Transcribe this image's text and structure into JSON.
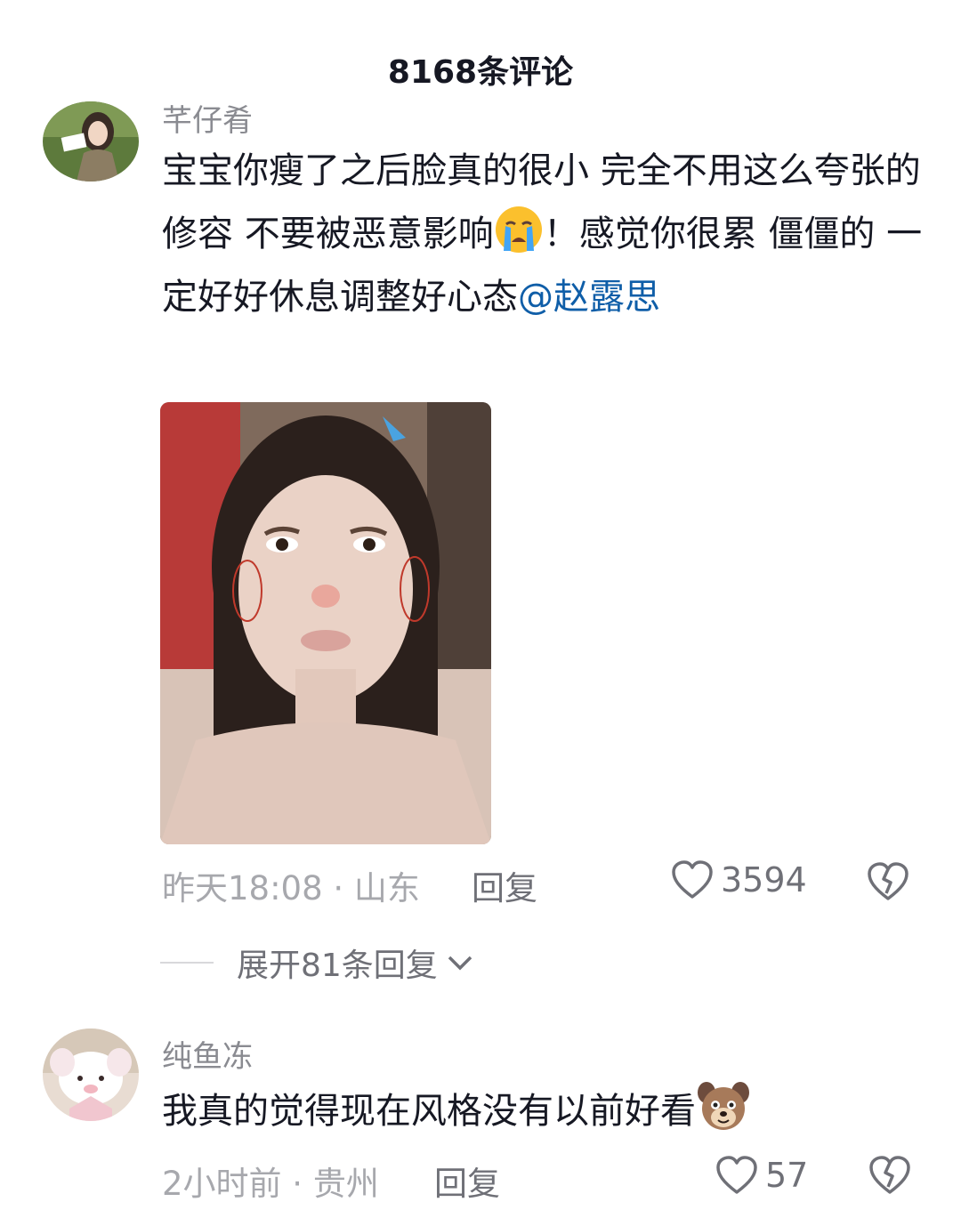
{
  "header": {
    "title": "8168条评论"
  },
  "comments": [
    {
      "username": "芊仔肴",
      "text_parts": [
        "宝宝你瘦了之后脸真的很小 完全不用这么夸张的修容 不要被恶意影响",
        "！感觉你很累 僵僵的 一定好好休息调整好心态"
      ],
      "mention": "@赵露思",
      "emoji": "crying-face-icon",
      "time_location": "昨天18:08 · 山东",
      "reply_label": "回复",
      "like_count": "3594",
      "expand_label": "展开81条回复"
    },
    {
      "username": "纯鱼冻",
      "text": "我真的觉得现在风格没有以前好看",
      "emoji": "dog-face-icon",
      "time_location": "2小时前 · 贵州",
      "reply_label": "回复",
      "like_count": "57"
    }
  ],
  "colors": {
    "mention": "#0f5ea8",
    "meta": "#a7a8ad",
    "text": "#161823"
  }
}
